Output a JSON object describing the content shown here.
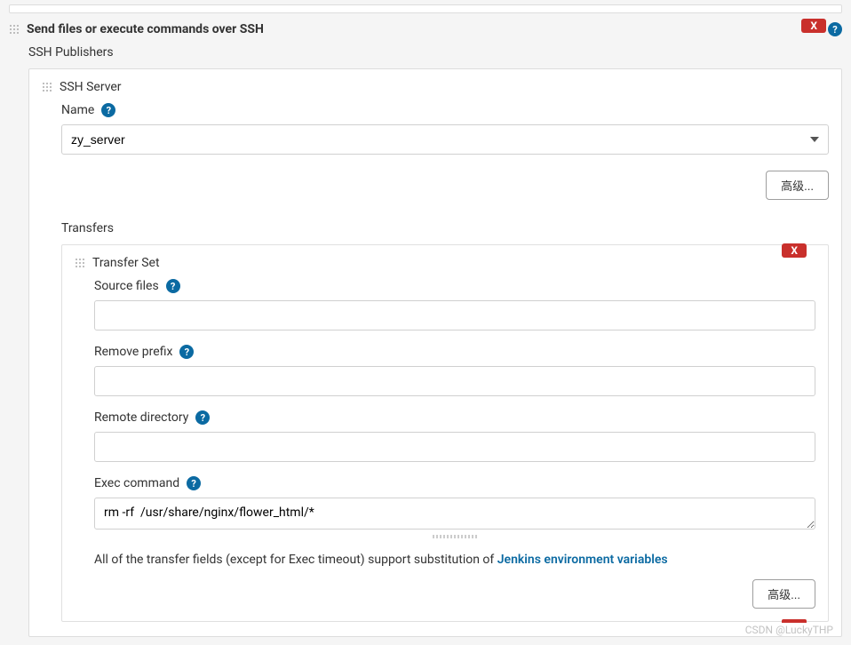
{
  "section": {
    "title": "Send files or execute commands over SSH",
    "delete_label": "X",
    "publishers_label": "SSH Publishers"
  },
  "ssh_server": {
    "title": "SSH Server",
    "name_label": "Name",
    "name_value": "zy_server",
    "advanced_label": "高级..."
  },
  "transfers": {
    "label": "Transfers",
    "set_title": "Transfer Set",
    "delete_label": "X",
    "source_files_label": "Source files",
    "source_files_value": "",
    "remove_prefix_label": "Remove prefix",
    "remove_prefix_value": "",
    "remote_directory_label": "Remote directory",
    "remote_directory_value": "",
    "exec_command_label": "Exec command",
    "exec_command_value": "rm -rf  /usr/share/nginx/flower_html/*",
    "info_prefix": "All of the transfer fields (except for Exec timeout) support substitution of ",
    "info_link": "Jenkins environment variables",
    "advanced_label": "高级..."
  },
  "watermark": "CSDN @LuckyTHP"
}
